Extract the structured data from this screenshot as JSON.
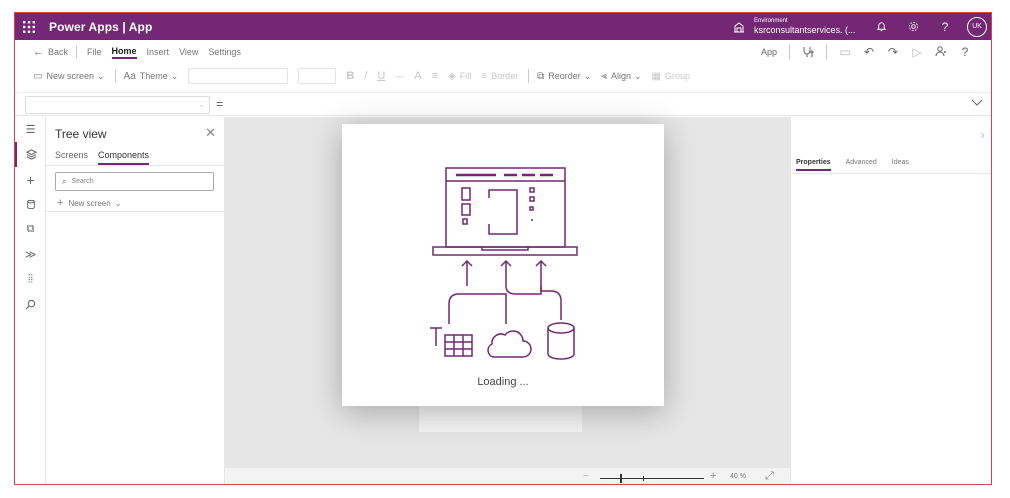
{
  "header": {
    "app_title": "Power Apps | App",
    "environment_label": "Environment",
    "environment_name": "ksrconsultantservices. (...",
    "avatar_initials": "UK",
    "icons": [
      "waffle-icon",
      "environment-icon",
      "bell-icon",
      "gear-icon",
      "help-icon"
    ],
    "accent": "#742774"
  },
  "menu": {
    "back": "Back",
    "items": [
      "File",
      "Home",
      "Insert",
      "View",
      "Settings"
    ],
    "active": "Home",
    "right_label": "App",
    "right_icons": [
      "app-checker-icon",
      "comment-icon",
      "undo-icon",
      "redo-icon",
      "play-icon",
      "share-icon",
      "help-icon"
    ]
  },
  "toolbar": {
    "new_screen": "New screen",
    "theme": "Theme",
    "bold": "B",
    "italic": "/",
    "underline": "U",
    "strike": "—",
    "font_color": "A",
    "align_text": "≡",
    "fill": "Fill",
    "border": "Border",
    "reorder": "Reorder",
    "align": "Align",
    "group": "Group"
  },
  "formula": {
    "equals": "="
  },
  "tree": {
    "title": "Tree view",
    "tabs": [
      "Screens",
      "Components"
    ],
    "active_tab": "Components",
    "search_placeholder": "Search",
    "new_screen": "New screen"
  },
  "canvas": {
    "loading_text": "Loading ..."
  },
  "status": {
    "zoom_minus": "−",
    "zoom_plus": "+",
    "zoom_value": "40 %"
  },
  "right_panel": {
    "tabs": [
      "Properties",
      "Advanced",
      "Ideas"
    ],
    "active_tab": "Properties"
  }
}
